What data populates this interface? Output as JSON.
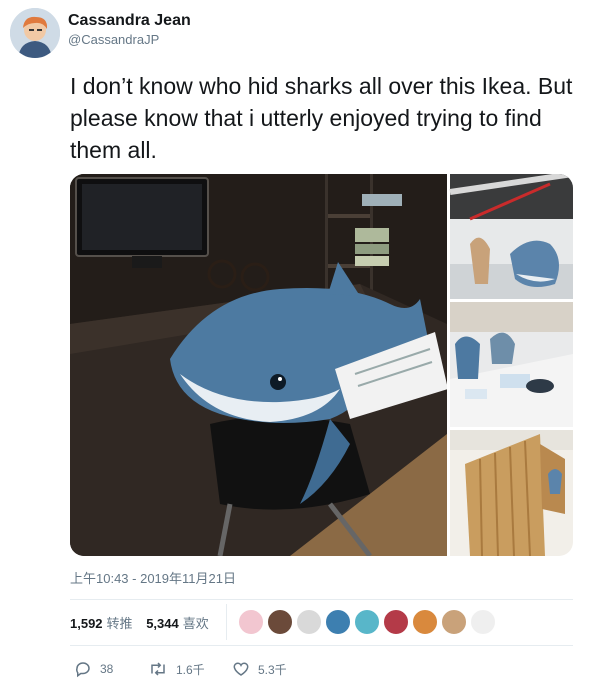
{
  "user": {
    "display_name": "Cassandra Jean",
    "handle": "@CassandraJP",
    "avatar_icon": "user-avatar-icon"
  },
  "tweet": {
    "text": "I don’t know who hid sharks all over this Ikea. But please know that i utterly enjoyed trying to find them all.",
    "timestamp": "上午10:43 - 2019年11月21日"
  },
  "media": {
    "photos": [
      "shark-on-office-chair-photo",
      "shark-in-store-aisle-photo",
      "shark-at-display-table-photo",
      "wooden-room-divider-photo"
    ]
  },
  "stats": {
    "retweets_count": "1,592",
    "retweets_label": "转推",
    "likes_count": "5,344",
    "likes_label": "喜欢",
    "liker_avatar_count": 9
  },
  "actions": {
    "reply_count": "38",
    "retweet_count": "1.6千",
    "like_count": "5.3千"
  },
  "colors": {
    "text": "#14171a",
    "secondary": "#657786",
    "divider": "#e6ecf0"
  }
}
